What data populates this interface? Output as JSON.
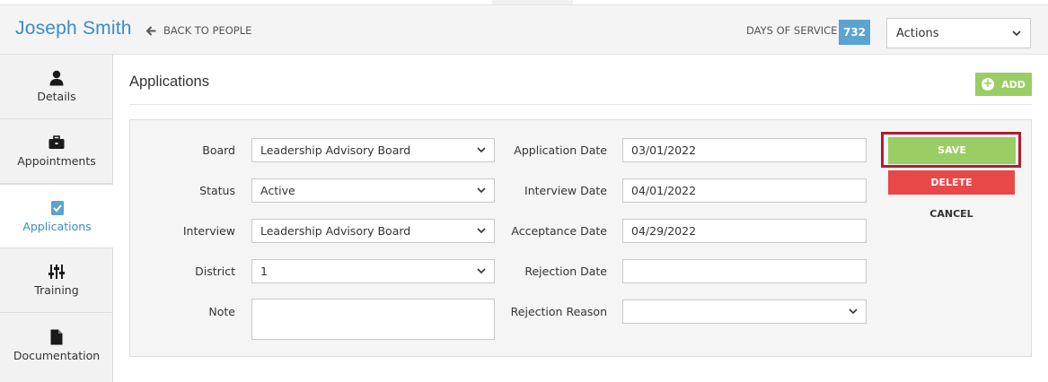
{
  "header": {
    "person_name": "Joseph Smith",
    "back_label": "BACK TO PEOPLE",
    "days_of_service_label": "DAYS OF SERVICE",
    "days_of_service_value": "732",
    "actions_select_value": "Actions"
  },
  "sidebar": {
    "items": [
      {
        "label": "Details",
        "icon": "person-icon"
      },
      {
        "label": "Appointments",
        "icon": "briefcase-icon"
      },
      {
        "label": "Applications",
        "icon": "checkbox-doc-icon",
        "active": true
      },
      {
        "label": "Training",
        "icon": "sliders-icon"
      },
      {
        "label": "Documentation",
        "icon": "document-icon"
      }
    ]
  },
  "main": {
    "section_title": "Applications",
    "add_label": "ADD"
  },
  "form": {
    "board": {
      "label": "Board",
      "value": "Leadership Advisory Board"
    },
    "status": {
      "label": "Status",
      "value": "Active"
    },
    "interview": {
      "label": "Interview",
      "value": "Leadership Advisory Board"
    },
    "district": {
      "label": "District",
      "value": "1"
    },
    "note": {
      "label": "Note",
      "value": ""
    },
    "application_date": {
      "label": "Application Date",
      "value": "03/01/2022"
    },
    "interview_date": {
      "label": "Interview Date",
      "value": "04/01/2022"
    },
    "acceptance_date": {
      "label": "Acceptance Date",
      "value": "04/29/2022"
    },
    "rejection_date": {
      "label": "Rejection Date",
      "value": ""
    },
    "rejection_reason": {
      "label": "Rejection Reason",
      "value": ""
    }
  },
  "buttons": {
    "save": "SAVE",
    "delete": "DELETE",
    "cancel": "CANCEL"
  },
  "colors": {
    "accent_blue": "#3a8cc6",
    "badge_blue": "#5ba3d0",
    "save_green": "#9acd63",
    "delete_red": "#e84848",
    "highlight_outline": "#b01c2e"
  }
}
